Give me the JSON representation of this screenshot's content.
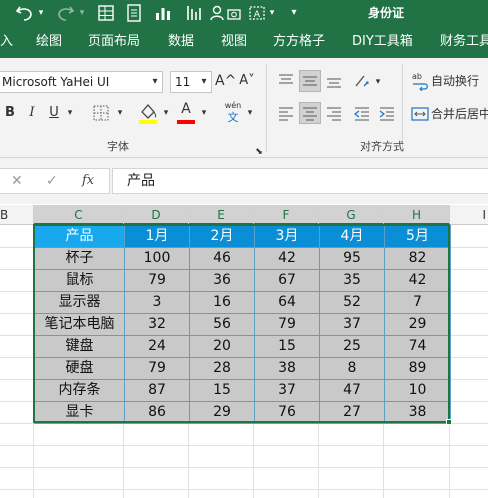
{
  "titlebar": {
    "doc_title": "身份证",
    "icons": [
      "save-icon",
      "undo-icon",
      "redo-icon",
      "table-icon",
      "form-icon",
      "chart-icon",
      "person-icon",
      "camera-icon",
      "text-box-icon",
      "customize-icon"
    ]
  },
  "tabs": [
    "入",
    "绘图",
    "页面布局",
    "数据",
    "视图",
    "方方格子",
    "DIY工具箱",
    "财务工具"
  ],
  "ribbon": {
    "font_name": "Microsoft YaHei UI",
    "font_size": "11",
    "font_grow": "A^",
    "font_shrink": "A˅",
    "bold": "B",
    "italic": "I",
    "underline": "U",
    "fill_color": "#FFFF00",
    "font_color": "#FF0000",
    "font_color_letter": "A",
    "phonetic_top": "wén",
    "phonetic_bottom": "文",
    "font_group_label": "字体",
    "align_group_label": "对齐方式",
    "wrap_text": "自动换行",
    "merge_center": "合并后居中"
  },
  "formula_bar": {
    "cancel": "✕",
    "enter": "✓",
    "fx": "fx",
    "value": "产品"
  },
  "columns": [
    "B",
    "C",
    "D",
    "E",
    "F",
    "G",
    "H",
    "I"
  ],
  "table": {
    "headers": [
      "产品",
      "1月",
      "2月",
      "3月",
      "4月",
      "5月"
    ],
    "rows": [
      [
        "杯子",
        "100",
        "46",
        "42",
        "95",
        "82"
      ],
      [
        "鼠标",
        "79",
        "36",
        "67",
        "35",
        "42"
      ],
      [
        "显示器",
        "3",
        "16",
        "64",
        "52",
        "7"
      ],
      [
        "笔记本电脑",
        "32",
        "56",
        "79",
        "37",
        "29"
      ],
      [
        "键盘",
        "24",
        "20",
        "15",
        "25",
        "74"
      ],
      [
        "硬盘",
        "79",
        "28",
        "38",
        "8",
        "89"
      ],
      [
        "内存条",
        "87",
        "15",
        "37",
        "47",
        "10"
      ],
      [
        "显卡",
        "86",
        "29",
        "76",
        "27",
        "38"
      ]
    ]
  },
  "colors": {
    "accent": "#217346",
    "table_header": "#0A8FD6",
    "table_body": "#C9C9C9"
  }
}
